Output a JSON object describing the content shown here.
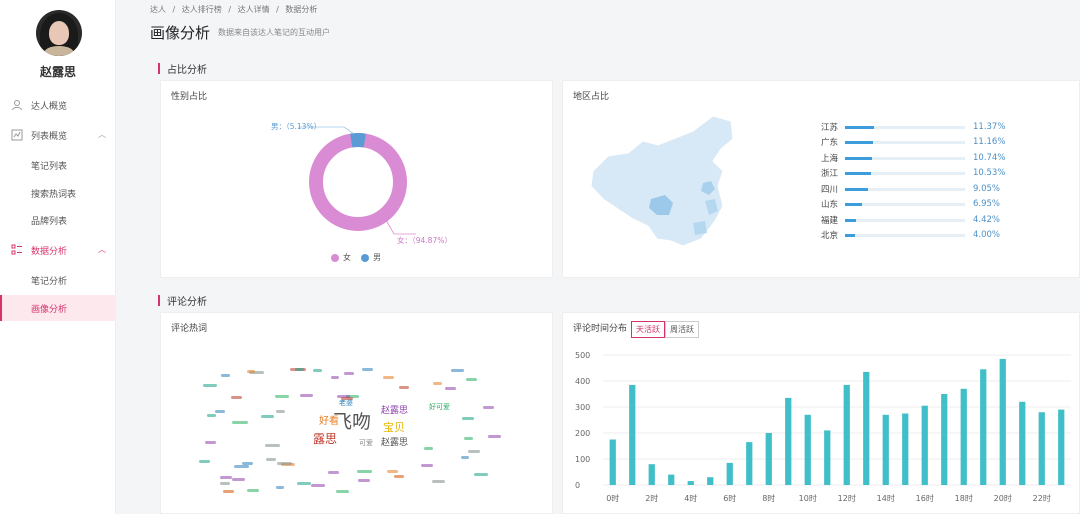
{
  "sidebar": {
    "username": "赵露思",
    "items": [
      {
        "label": "达人概览"
      },
      {
        "label": "列表概览"
      },
      {
        "label": "笔记列表"
      },
      {
        "label": "搜索热词表"
      },
      {
        "label": "品牌列表"
      },
      {
        "label": "数据分析"
      },
      {
        "label": "笔记分析"
      },
      {
        "label": "画像分析"
      }
    ]
  },
  "breadcrumb": [
    "达人",
    "/",
    "达人排行榜",
    "/",
    "达人详情",
    "/",
    "数据分析"
  ],
  "header": {
    "title": "画像分析",
    "subtitle": "数据来自该达人笔记的互动用户"
  },
  "sections": {
    "ratio": "占比分析",
    "comment": "评论分析"
  },
  "gender": {
    "title": "性别占比",
    "male_label": "男：（5.13%）",
    "female_label": "女：（94.87%）",
    "legend_female": "女",
    "legend_male": "男",
    "female_color": "#d98bd3",
    "male_color": "#5b9bd5"
  },
  "region": {
    "title": "地区占比",
    "rows": [
      {
        "name": "江苏",
        "pct": "11.37%",
        "value": 11.37
      },
      {
        "name": "广东",
        "pct": "11.16%",
        "value": 11.16
      },
      {
        "name": "上海",
        "pct": "10.74%",
        "value": 10.74
      },
      {
        "name": "浙江",
        "pct": "10.53%",
        "value": 10.53
      },
      {
        "name": "四川",
        "pct": "9.05%",
        "value": 9.05
      },
      {
        "name": "山东",
        "pct": "6.95%",
        "value": 6.95
      },
      {
        "name": "福建",
        "pct": "4.42%",
        "value": 4.42
      },
      {
        "name": "北京",
        "pct": "4.00%",
        "value": 4.0
      }
    ]
  },
  "wordcloud": {
    "title": "评论热词",
    "words": [
      {
        "t": "飞吻",
        "c": "#555"
      },
      {
        "t": "露思",
        "c": "#c0392b"
      },
      {
        "t": "好看",
        "c": "#e67e22"
      },
      {
        "t": "宝贝",
        "c": "#f1c40f"
      },
      {
        "t": "赵露思",
        "c": "#8e44ad"
      },
      {
        "t": "赵露思",
        "c": "#555"
      },
      {
        "t": "可爱",
        "c": "#888"
      },
      {
        "t": "好可爱",
        "c": "#27ae60"
      },
      {
        "t": "老婆",
        "c": "#2980b9"
      }
    ]
  },
  "time_chart": {
    "title": "评论时间分布",
    "tab_active": "天活跃",
    "tab_other": "周活跃"
  },
  "chart_data": {
    "type": "bar",
    "categories": [
      "0时",
      "1时",
      "2时",
      "3时",
      "4时",
      "5时",
      "6时",
      "7时",
      "8时",
      "9时",
      "10时",
      "11时",
      "12时",
      "13时",
      "14时",
      "15时",
      "16时",
      "17时",
      "18时",
      "19时",
      "20时",
      "21时",
      "22时",
      "23时"
    ],
    "tick_labels": [
      "0时",
      "2时",
      "4时",
      "6时",
      "8时",
      "10时",
      "12时",
      "14时",
      "16时",
      "18时",
      "20时",
      "22时"
    ],
    "y_ticks": [
      "0",
      "100",
      "200",
      "300",
      "400",
      "500"
    ],
    "values": [
      175,
      385,
      80,
      40,
      15,
      30,
      85,
      165,
      200,
      335,
      270,
      210,
      385,
      435,
      270,
      275,
      305,
      350,
      370,
      445,
      485,
      320,
      280,
      290
    ],
    "ylim": [
      0,
      500
    ],
    "color": "#40bfc8",
    "grid": true
  }
}
